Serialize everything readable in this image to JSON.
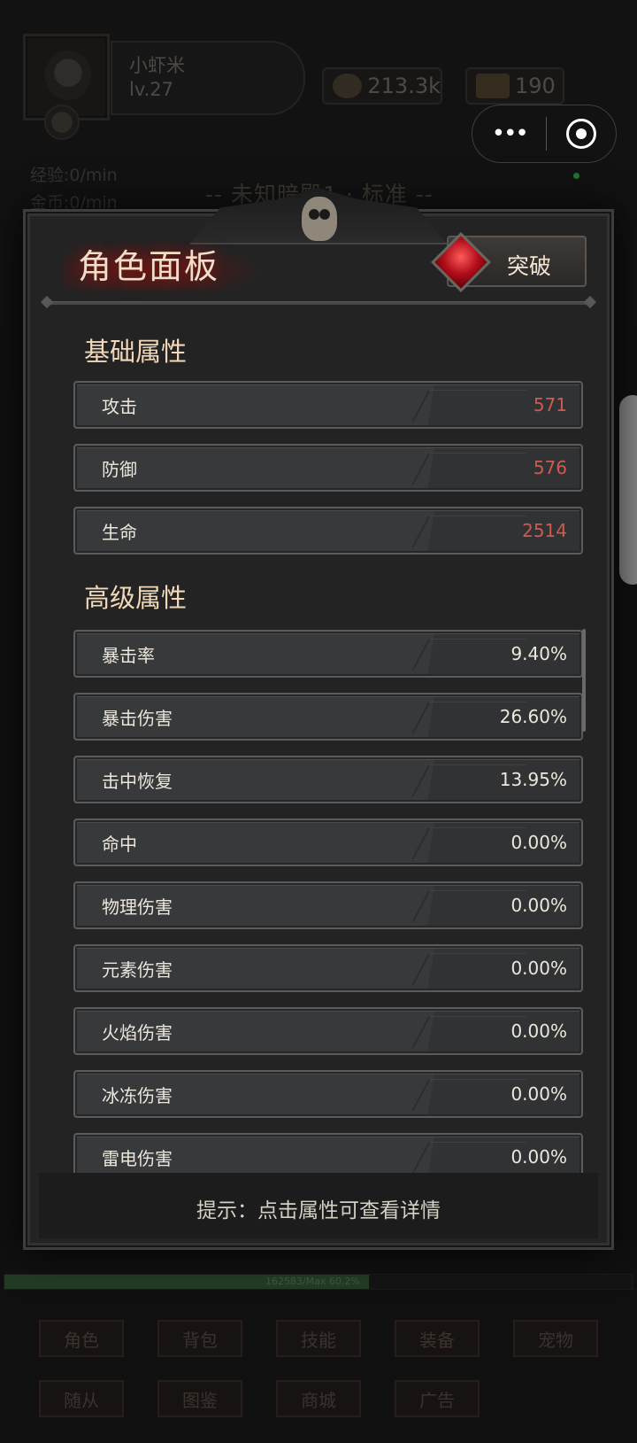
{
  "player": {
    "name": "小虾米",
    "level": "lv.27"
  },
  "resources": {
    "gold": "213.3k",
    "bars": "190"
  },
  "background_stats": {
    "exp": "经验:0/min",
    "coin": "金币:0/min"
  },
  "stage_title": "-- 未知暗殿1 · 标准 --",
  "capsule": {
    "more": "•••"
  },
  "hp_bar": {
    "text": "162583/Max    60.2%",
    "fill_percent": 58
  },
  "nav": [
    "角色",
    "背包",
    "技能",
    "装备",
    "宠物",
    "随从",
    "图鉴",
    "商城",
    "广告"
  ],
  "panel": {
    "title": "角色面板",
    "break_button": "突破",
    "basic_title": "基础属性",
    "basic": [
      {
        "label": "攻击",
        "value": "571"
      },
      {
        "label": "防御",
        "value": "576"
      },
      {
        "label": "生命",
        "value": "2514"
      }
    ],
    "advanced_title": "高级属性",
    "advanced": [
      {
        "label": "暴击率",
        "value": "9.40%"
      },
      {
        "label": "暴击伤害",
        "value": "26.60%"
      },
      {
        "label": "击中恢复",
        "value": "13.95%"
      },
      {
        "label": "命中",
        "value": "0.00%"
      },
      {
        "label": "物理伤害",
        "value": "0.00%"
      },
      {
        "label": "元素伤害",
        "value": "0.00%"
      },
      {
        "label": "火焰伤害",
        "value": "0.00%"
      },
      {
        "label": "冰冻伤害",
        "value": "0.00%"
      },
      {
        "label": "雷电伤害",
        "value": "0.00%"
      }
    ],
    "hint": "提示：点击属性可查看详情"
  },
  "colors": {
    "basic_value": "#d05a4f",
    "advanced_value": "#ece7dd",
    "title_glow": "#8c1010",
    "gem": "#c8102e"
  },
  "icons": [
    "gear-skull-icon",
    "skull-icon",
    "coins-icon",
    "gold-bar-icon",
    "more-dots-icon",
    "close-circle-icon",
    "ruby-gem-icon"
  ]
}
